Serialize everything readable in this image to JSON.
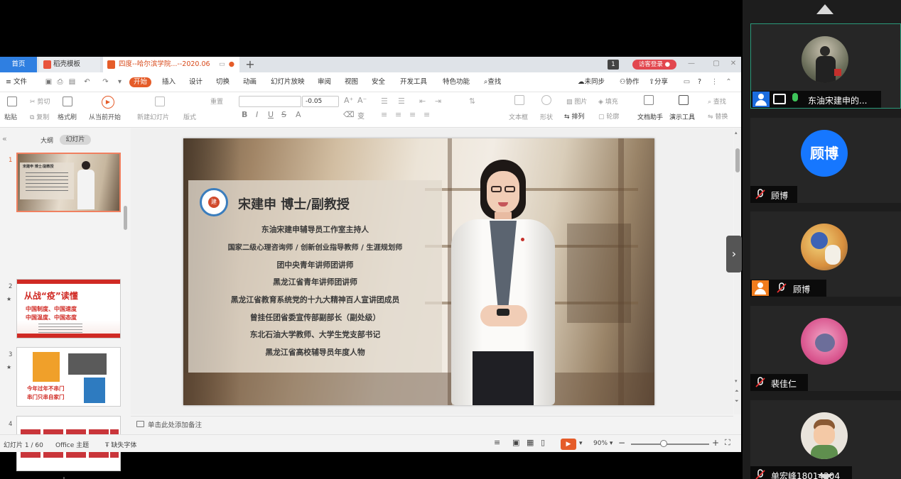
{
  "tabs": {
    "home": "首页",
    "docer": "稻壳模板",
    "doc": "四度--哈尔滨学院...--2020.06",
    "plus": "+",
    "page_badge": "1",
    "login": "访客登录"
  },
  "menu": {
    "file": "文件",
    "items": [
      "开始",
      "插入",
      "设计",
      "切换",
      "动画",
      "幻灯片放映",
      "审阅",
      "视图",
      "安全",
      "开发工具",
      "特色功能"
    ],
    "search": "查找",
    "sync": "未同步",
    "collab": "协作",
    "share": "分享",
    "help": "?"
  },
  "ribbon": {
    "paste": "粘贴",
    "cut": "剪切",
    "copy": "复制",
    "format_painter": "格式刷",
    "play_from_current": "从当前开始",
    "new_slide": "新建幻灯片",
    "layout": "版式",
    "reset": "重置",
    "font_size": "-0.05",
    "textbox": "文本框",
    "shape": "形状",
    "arrange": "排列",
    "outline": "轮廓",
    "picture": "图片",
    "fill": "填充",
    "doc_assistant": "文档助手",
    "presentation_tools": "演示工具",
    "find": "查找",
    "replace": "替换"
  },
  "left_panel": {
    "outline_tab": "大纲",
    "slides_tab": "幻灯片",
    "thumbnails": [
      {
        "num": "1",
        "header": "宋建申 博士/副教授"
      },
      {
        "num": "2",
        "title": "从战“疫”读懂",
        "sub1": "中国制度、中国速度",
        "sub2": "中国温度、中国态度"
      },
      {
        "num": "3",
        "title": "今年过年不串门",
        "sub": "串门只串自家门"
      },
      {
        "num": "4"
      }
    ]
  },
  "slide": {
    "title": "宋建申  博士/副教授",
    "logo_char": "建",
    "lines": [
      "东油宋建申辅导员工作室主持人",
      "国家二级心理咨询师 / 创新创业指导教师 / 生涯规划师",
      "团中央青年讲师团讲师",
      "黑龙江省青年讲师团讲师",
      "黑龙江省教育系统党的十九大精神百人宣讲团成员",
      "曾挂任团省委宣传部副部长（副处级）",
      "东北石油大学教师、大学生党支部书记",
      "黑龙江省高校辅导员年度人物"
    ]
  },
  "notes": {
    "placeholder": "单击此处添加备注"
  },
  "status": {
    "slide_counter": "幻灯片 1 / 60",
    "theme": "Office 主题",
    "missing_font": "缺失字体",
    "zoom": "90%",
    "zoom_minus": "−",
    "zoom_plus": "+"
  },
  "participants": [
    {
      "name": "东油宋建申的...",
      "avatar": "photo"
    },
    {
      "name": "顾博",
      "avatar_text": "顾博",
      "avatar_color": "#1677ff"
    },
    {
      "name": "顾博",
      "avatar": "cartoon"
    },
    {
      "name": "裴佳仁",
      "avatar": "pink"
    },
    {
      "name": "单宏峰18014204",
      "avatar": "boy"
    }
  ],
  "colors": {
    "accent": "#e55c29",
    "tab_blue": "#2f7fe1",
    "login_red": "#e2474f",
    "active_border": "#2b9a7a"
  }
}
